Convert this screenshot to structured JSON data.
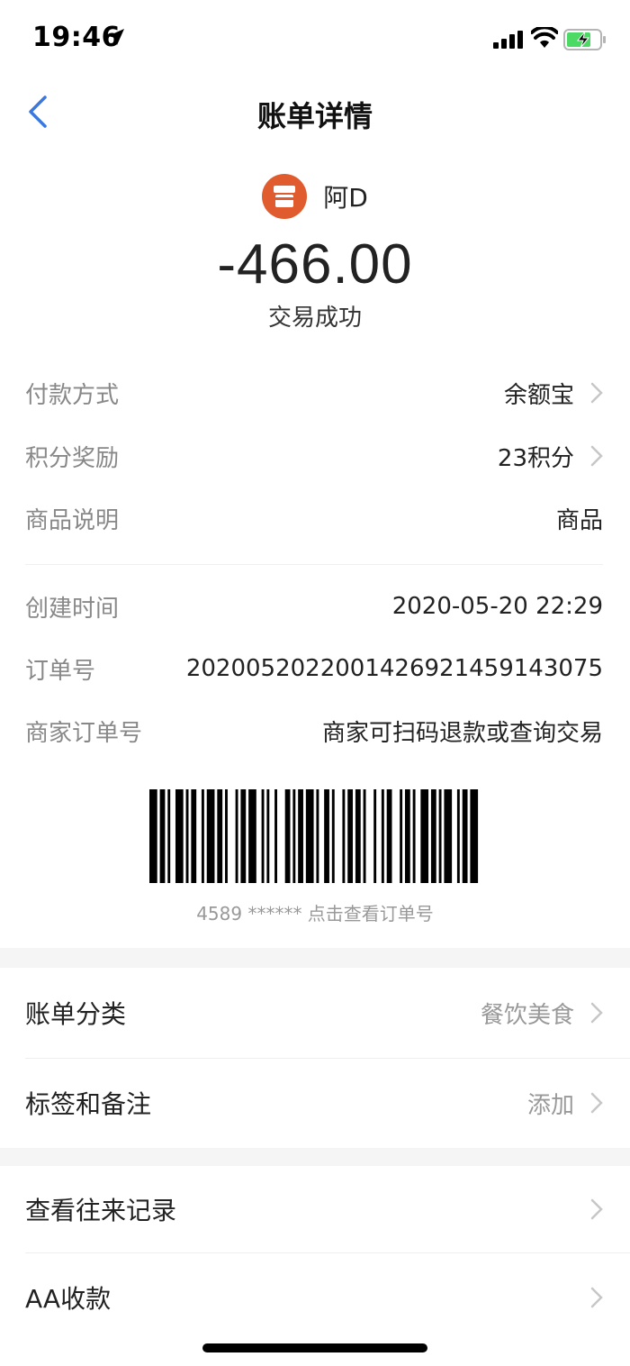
{
  "status_bar": {
    "time": "19:46"
  },
  "nav": {
    "title": "账单详情"
  },
  "header": {
    "merchant_name": "阿D",
    "amount": "-466.00",
    "status": "交易成功"
  },
  "details": [
    {
      "label": "付款方式",
      "value": "余额宝",
      "has_arrow": true
    },
    {
      "label": "积分奖励",
      "value": "23积分",
      "has_arrow": true
    },
    {
      "label": "商品说明",
      "value": "商品",
      "has_arrow": false
    }
  ],
  "order_info": [
    {
      "label": "创建时间",
      "value": "2020-05-20 22:29"
    },
    {
      "label": "订单号",
      "value": "2020052022001426921459143075"
    },
    {
      "label": "商家订单号",
      "value": "商家可扫码退款或查询交易"
    }
  ],
  "barcode": {
    "caption": "4589 ****** 点击查看订单号"
  },
  "actions_1": [
    {
      "label": "账单分类",
      "value": "餐饮美食"
    },
    {
      "label": "标签和备注",
      "value": "添加"
    }
  ],
  "actions_2": [
    {
      "label": "查看往来记录",
      "value": ""
    },
    {
      "label": "AA收款",
      "value": ""
    }
  ],
  "colors": {
    "accent_blue": "#3a78e0",
    "store_orange": "#e05c2f",
    "battery_green": "#4cd964"
  }
}
